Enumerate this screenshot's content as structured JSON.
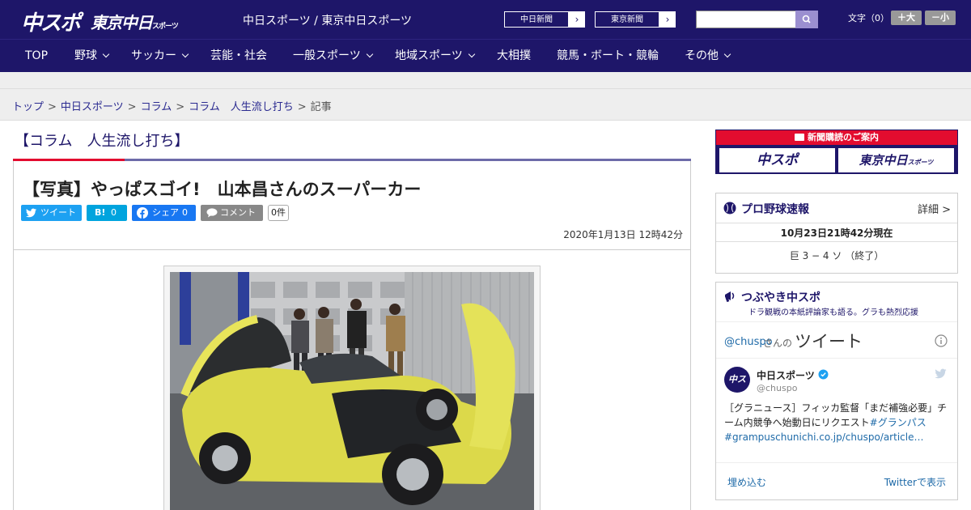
{
  "header": {
    "logo_chuspo": "中スポ",
    "logo_tokyo": "東京中日",
    "logo_tokyo_small": "スポーツ",
    "site_title": "中日スポーツ / 東京中日スポーツ",
    "paper_links": [
      {
        "label": "中日新聞"
      },
      {
        "label": "東京新聞"
      }
    ],
    "font_size_label": "文字（0）",
    "font_bigger": "＋大",
    "font_smaller": "－小",
    "colors": {
      "primary": "#1e1669",
      "accent_red": "#e30c2f",
      "link": "#2a2a90"
    }
  },
  "nav": {
    "items": [
      {
        "label": "TOP"
      },
      {
        "label": "野球"
      },
      {
        "label": "サッカー"
      },
      {
        "label": "芸能・社会"
      },
      {
        "label": "一般スポーツ"
      },
      {
        "label": "地域スポーツ"
      },
      {
        "label": "大相撲"
      },
      {
        "label": "競馬・ボート・競輪"
      },
      {
        "label": "その他"
      }
    ]
  },
  "breadcrumb": {
    "items": [
      "トップ",
      "中日スポーツ",
      "コラム",
      "コラム　人生流し打ち"
    ],
    "current": "記事",
    "separator": ">"
  },
  "article": {
    "column_title": "【コラム　人生流し打ち】",
    "title": "【写真】やっぱスゴイ!　山本昌さんのスーパーカー",
    "share": {
      "tweet": "ツイート",
      "hatena": "B!",
      "hatena_count": "0",
      "facebook": "シェア",
      "facebook_count": "0",
      "comment": "コメント",
      "comment_count": "0件"
    },
    "date": "2020年1月13日 12時42分"
  },
  "sidebar": {
    "subscription": {
      "header": "新聞購読のご案内",
      "logo_a": "中スポ",
      "logo_b": "東京中日",
      "logo_b_small": "スポーツ"
    },
    "baseball": {
      "title": "プロ野球速報",
      "more": "詳細 >",
      "timestamp": "10月23日21時42分現在",
      "score": "巨 3 − 4 ソ （終了）"
    },
    "twitter": {
      "title": "つぶやき中スポ",
      "subtitle": "ドラ観戦の本紙評論家も語る。グラも熱烈応援",
      "handle": "@chuspo",
      "handle_suffix": "さんの",
      "heading": "ツイート",
      "account_name": "中日スポーツ",
      "account_handle": "@chuspo",
      "tweet_text": "［グラニュース］フィッカ監督「まだ補強必要」チーム内競争へ始動日にリクエスト",
      "tweet_hashtag": "#グランパス",
      "tweet_link": "#grampuschunichi.co.jp/chuspo/article…",
      "embed": "埋め込む",
      "view_on": "Twitterで表示"
    }
  }
}
